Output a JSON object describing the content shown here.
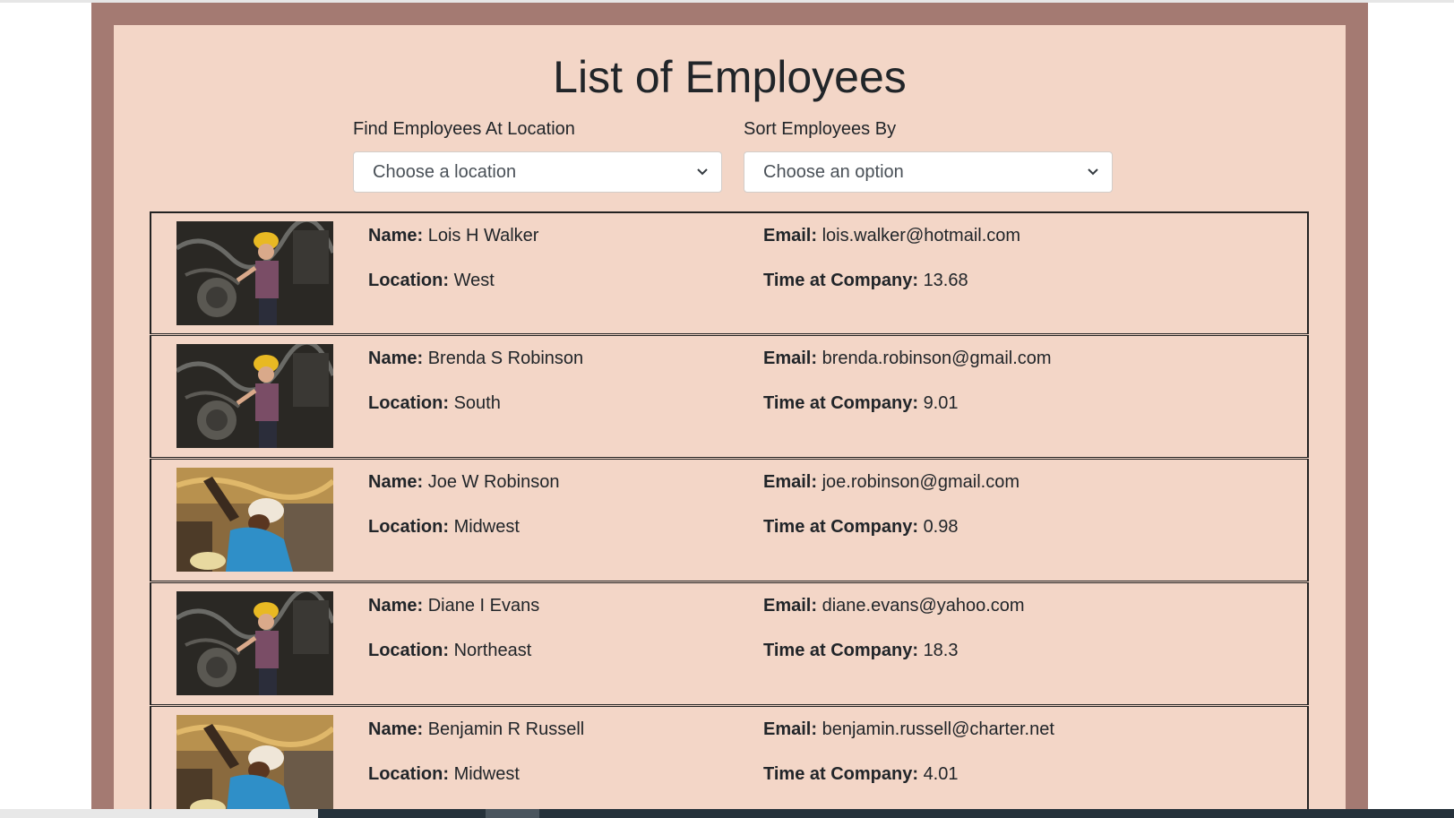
{
  "page": {
    "title": "List of Employees"
  },
  "filters": {
    "location_label": "Find Employees At Location",
    "location_value": "Choose a location",
    "sort_label": "Sort Employees By",
    "sort_value": "Choose an option"
  },
  "field_labels": {
    "name": "Name:",
    "location": "Location:",
    "email": "Email:",
    "time": "Time at Company:"
  },
  "employees": [
    {
      "name": "Lois H Walker",
      "location": "West",
      "email": "lois.walker@hotmail.com",
      "time": "13.68",
      "photo": "mechanic-yellow-hardhat"
    },
    {
      "name": "Brenda S Robinson",
      "location": "South",
      "email": "brenda.robinson@gmail.com",
      "time": "9.01",
      "photo": "mechanic-yellow-hardhat"
    },
    {
      "name": "Joe W Robinson",
      "location": "Midwest",
      "email": "joe.robinson@gmail.com",
      "time": "0.98",
      "photo": "worker-white-hardhat"
    },
    {
      "name": "Diane I Evans",
      "location": "Northeast",
      "email": "diane.evans@yahoo.com",
      "time": "18.3",
      "photo": "mechanic-yellow-hardhat"
    },
    {
      "name": "Benjamin R Russell",
      "location": "Midwest",
      "email": "benjamin.russell@charter.net",
      "time": "4.01",
      "photo": "worker-white-hardhat"
    }
  ],
  "colors": {
    "frame": "#a47a72",
    "panel": "#f3d6c7",
    "text": "#212529"
  }
}
